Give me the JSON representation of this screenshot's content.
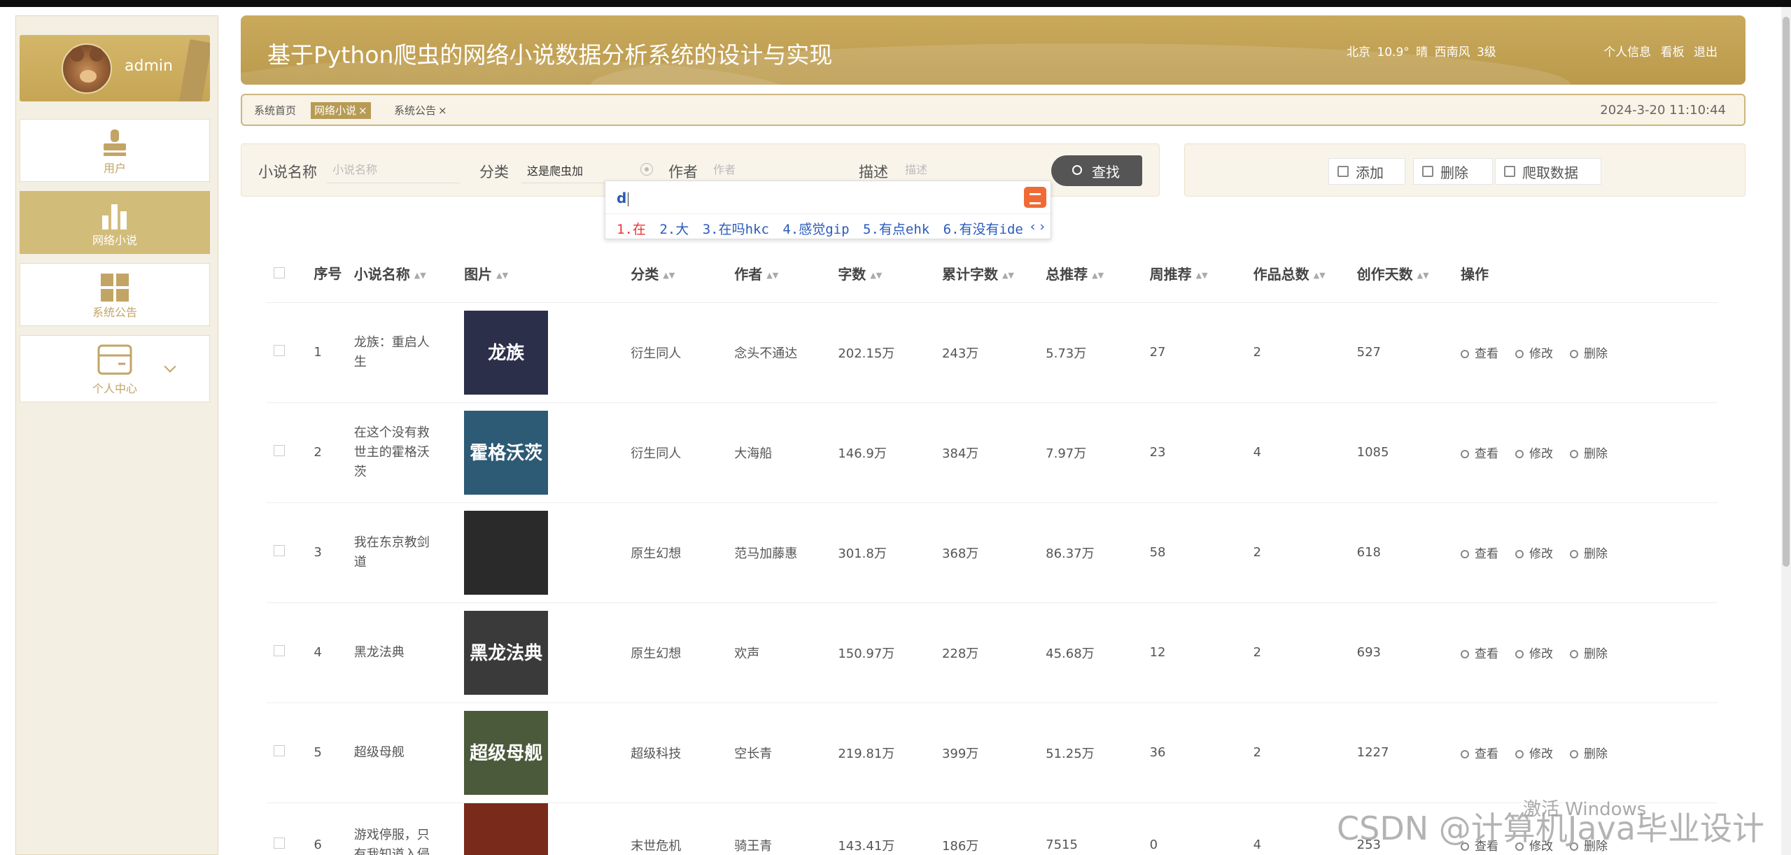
{
  "sidebar": {
    "username": "admin",
    "items": [
      {
        "label": "用户",
        "icon": "user-icon"
      },
      {
        "label": "网络小说",
        "icon": "bar-chart-icon"
      },
      {
        "label": "系统公告",
        "icon": "grid-icon"
      },
      {
        "label": "个人中心",
        "icon": "card-icon"
      }
    ]
  },
  "header": {
    "title": "基于Python爬虫的网络小说数据分析系统的设计与实现",
    "weather": "北京  10.9°  晴  西南风  3级",
    "links": [
      "个人信息",
      "看板",
      "退出"
    ]
  },
  "tabs": {
    "items": [
      {
        "label": "系统首页",
        "closable": false
      },
      {
        "label": "网络小说",
        "closable": true
      },
      {
        "label": "系统公告",
        "closable": true
      }
    ],
    "close_glyph": "×",
    "datetime": "2024-3-20 11:10:44"
  },
  "search": {
    "name_label": "小说名称",
    "name_placeholder": "小说名称",
    "category_label": "分类",
    "category_value": "这是爬虫加",
    "author_label": "作者",
    "author_placeholder": "作者",
    "desc_label": "描述",
    "desc_placeholder": "描述",
    "button": "查找"
  },
  "ime": {
    "composition": "d",
    "candidates": [
      "1.在",
      "2.大",
      "3.在吗hkc",
      "4.感觉gip",
      "5.有点ehk",
      "6.有没有ide"
    ],
    "arrows": "‹ ›"
  },
  "actions": {
    "add": "添加",
    "delete": "删除",
    "crawl": "爬取数据"
  },
  "table": {
    "columns": [
      "序号",
      "小说名称",
      "图片",
      "分类",
      "作者",
      "字数",
      "累计字数",
      "总推荐",
      "周推荐",
      "作品总数",
      "创作天数",
      "操作"
    ],
    "ops": [
      "查看",
      "修改",
      "删除"
    ],
    "rows": [
      {
        "no": "1",
        "name": "龙族：重启人生",
        "cover_text": "龙族",
        "cover_color": "#2b2f4a",
        "category": "衍生同人",
        "author": "念头不通达",
        "words": "202.15万",
        "total_words": "243万",
        "total_rec": "5.73万",
        "week_rec": "27",
        "works": "2",
        "days": "527"
      },
      {
        "no": "2",
        "name": "在这个没有救世主的霍格沃茨",
        "cover_text": "霍格沃茨",
        "cover_color": "#2d5a74",
        "category": "衍生同人",
        "author": "大海船",
        "words": "146.9万",
        "total_words": "384万",
        "total_rec": "7.97万",
        "week_rec": "23",
        "works": "4",
        "days": "1085"
      },
      {
        "no": "3",
        "name": "我在东京教剑道",
        "cover_text": "",
        "cover_color": "#2a2a2a",
        "category": "原生幻想",
        "author": "范马加藤惠",
        "words": "301.8万",
        "total_words": "368万",
        "total_rec": "86.37万",
        "week_rec": "58",
        "works": "2",
        "days": "618"
      },
      {
        "no": "4",
        "name": "黑龙法典",
        "cover_text": "黑龙法典",
        "cover_color": "#3a3a3a",
        "category": "原生幻想",
        "author": "欢声",
        "words": "150.97万",
        "total_words": "228万",
        "total_rec": "45.68万",
        "week_rec": "12",
        "works": "2",
        "days": "693"
      },
      {
        "no": "5",
        "name": "超级母舰",
        "cover_text": "超级母舰",
        "cover_color": "#4a5a3a",
        "category": "超级科技",
        "author": "空长青",
        "words": "219.81万",
        "total_words": "399万",
        "total_rec": "51.25万",
        "week_rec": "36",
        "works": "2",
        "days": "1227"
      },
      {
        "no": "6",
        "name": "游戏停服，只有我知道入侵",
        "cover_text": "",
        "cover_color": "#7a2a1a",
        "category": "末世危机",
        "author": "骑王青",
        "words": "143.41万",
        "total_words": "186万",
        "total_rec": "7515",
        "week_rec": "0",
        "works": "4",
        "days": "253"
      }
    ]
  },
  "watermarks": {
    "windows": "激活 Windows",
    "csdn": "CSDN @计算机Java毕业设计"
  }
}
